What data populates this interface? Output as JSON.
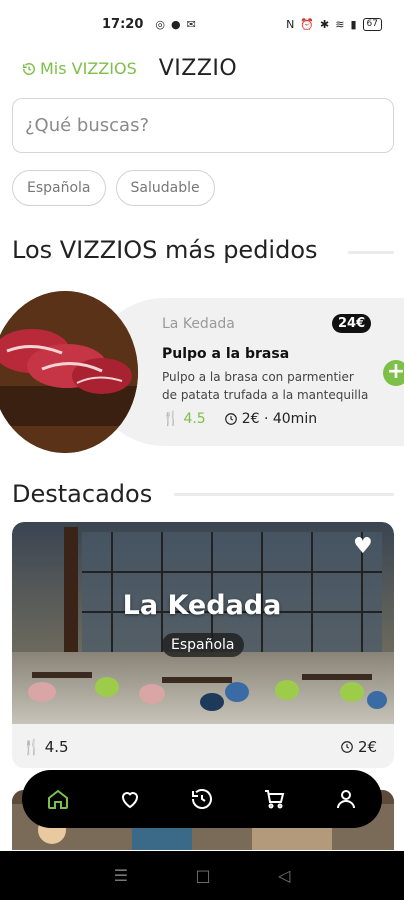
{
  "status": {
    "time": "17:20",
    "battery": "67"
  },
  "header": {
    "mis_vizzios": "Mis VIZZIOS",
    "brand": "VIZZIO"
  },
  "search": {
    "placeholder": "¿Qué buscas?"
  },
  "filters": [
    "Española",
    "Saludable"
  ],
  "popular": {
    "title": "Los VIZZIOS más pedidos",
    "item": {
      "restaurant": "La Kedada",
      "price": "24€",
      "name": "Pulpo a la brasa",
      "description": "Pulpo a la brasa con parmentier de patata trufada a la mantequilla",
      "rating": "4.5",
      "delivery": "2€ · 40min"
    }
  },
  "featured": {
    "title": "Destacados",
    "restaurant": {
      "name": "La Kedada",
      "cuisine": "Española",
      "rating": "4.5",
      "delivery_fee": "2€"
    }
  },
  "nav": {
    "items": [
      "home-icon",
      "heart-icon",
      "history-icon",
      "cart-icon",
      "profile-icon"
    ],
    "active_color": "#7cc04a"
  },
  "colors": {
    "accent": "#7cc04a"
  }
}
